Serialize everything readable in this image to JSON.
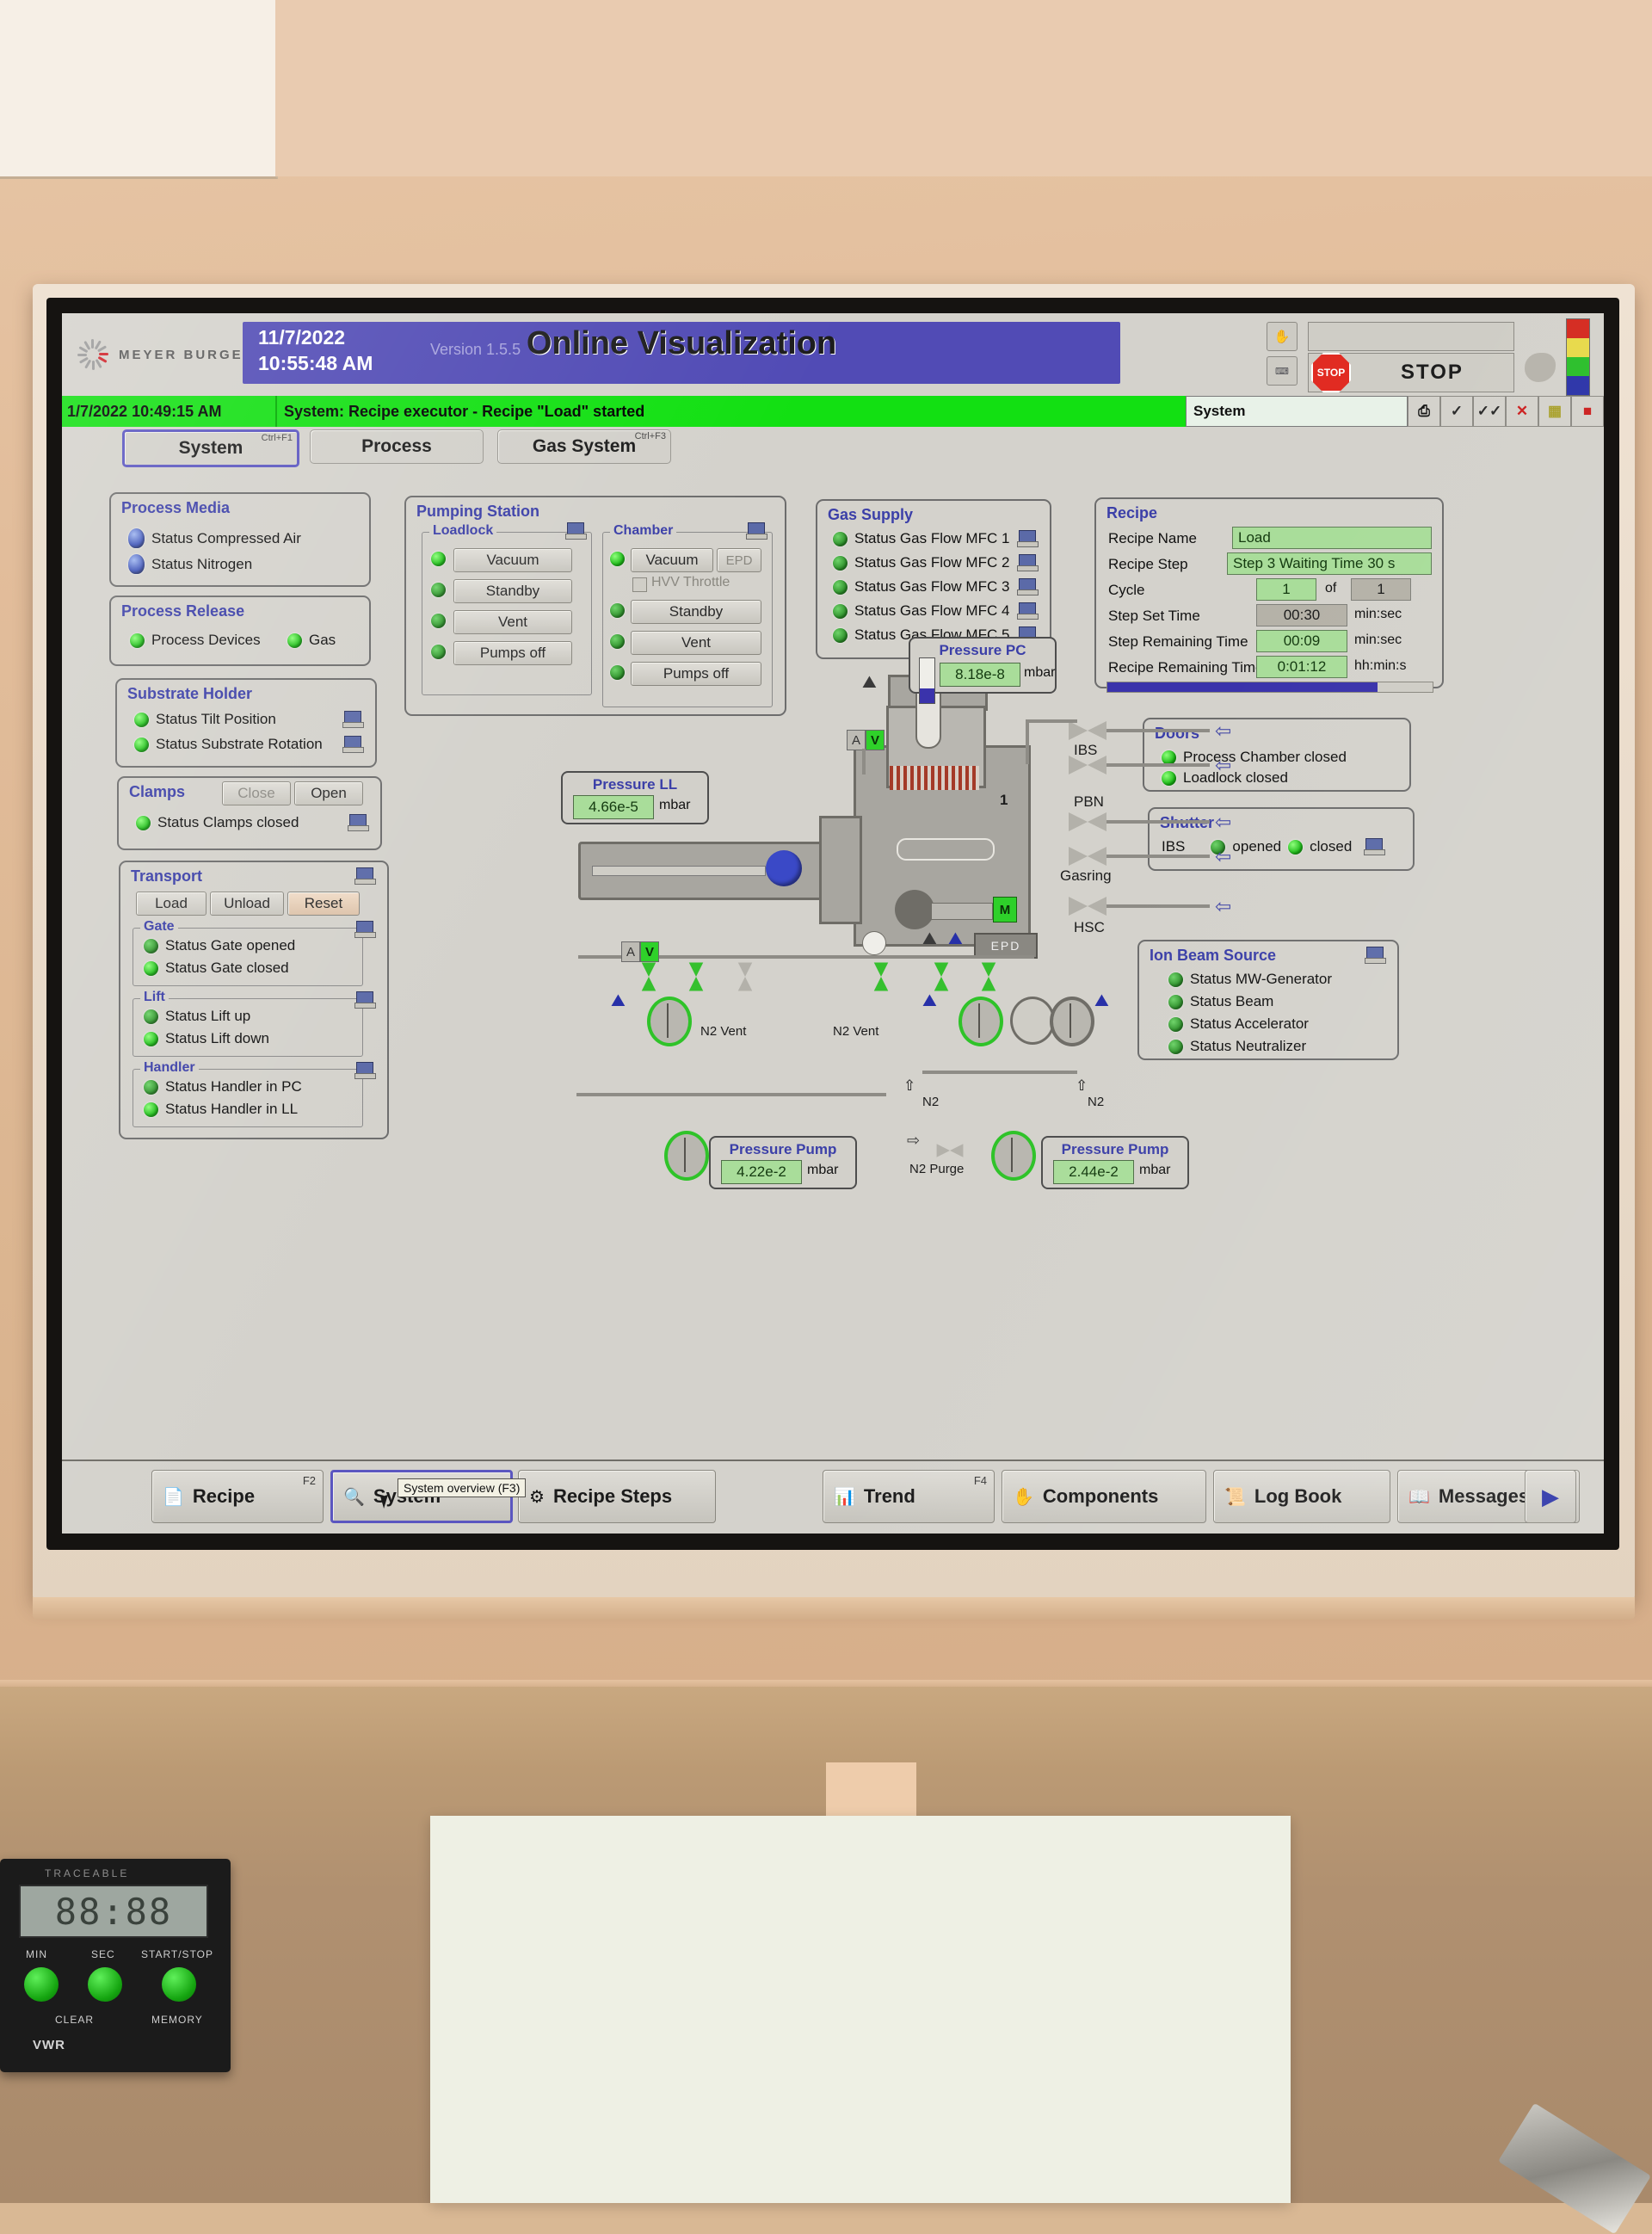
{
  "app": {
    "brand": "MEYER BURGER",
    "datetime": {
      "date": "11/7/2022",
      "time": "10:55:48 AM"
    },
    "version": "Version 1.5.5",
    "title": "Online Visualization",
    "stop_button": "STOP",
    "stop_icon_label": "STOP",
    "header_field_value": "",
    "lamp_colors": [
      "#d42a20",
      "#e8d94a",
      "#2bbf2b",
      "#2c34a8"
    ]
  },
  "alarm": {
    "time": "1/7/2022 10:49:15 AM",
    "message": "System: Recipe executor - Recipe \"Load\" started",
    "source": "System",
    "buttons": [
      "⎙",
      "✓",
      "✓✓",
      "✕",
      "▦",
      "■"
    ]
  },
  "tabs": [
    {
      "label": "System",
      "hotkey": "Ctrl+F1",
      "selected": true
    },
    {
      "label": "Process",
      "hotkey": "",
      "selected": false
    },
    {
      "label": "Gas System",
      "hotkey": "Ctrl+F3",
      "selected": false
    }
  ],
  "process_media": {
    "title": "Process Media",
    "items": [
      {
        "label": "Status Compressed Air",
        "icon": "gauge-icon"
      },
      {
        "label": "Status Nitrogen",
        "icon": "gauge-icon"
      }
    ]
  },
  "process_release": {
    "title": "Process Release",
    "items": [
      {
        "label": "Process Devices",
        "state": "on"
      },
      {
        "label": "Gas",
        "state": "on"
      }
    ]
  },
  "substrate_holder": {
    "title": "Substrate Holder",
    "items": [
      {
        "label": "Status Tilt Position",
        "state": "on"
      },
      {
        "label": "Status Substrate Rotation",
        "state": "on"
      }
    ]
  },
  "clamps": {
    "title": "Clamps",
    "buttons": [
      "Close",
      "Open"
    ],
    "items": [
      {
        "label": "Status Clamps closed",
        "state": "on"
      }
    ]
  },
  "transport": {
    "title": "Transport",
    "buttons": [
      "Load",
      "Unload",
      "Reset"
    ],
    "gate": {
      "title": "Gate",
      "items": [
        {
          "label": "Status Gate opened",
          "state": "dim"
        },
        {
          "label": "Status Gate closed",
          "state": "on"
        }
      ]
    },
    "lift": {
      "title": "Lift",
      "items": [
        {
          "label": "Status Lift up",
          "state": "dim"
        },
        {
          "label": "Status Lift down",
          "state": "on"
        }
      ]
    },
    "handler": {
      "title": "Handler",
      "items": [
        {
          "label": "Status Handler in PC",
          "state": "dim"
        },
        {
          "label": "Status Handler in LL",
          "state": "on"
        }
      ]
    }
  },
  "pumping_station": {
    "title": "Pumping Station",
    "loadlock": {
      "title": "Loadlock",
      "buttons": [
        {
          "label": "Vacuum",
          "state": "on"
        },
        {
          "label": "Standby",
          "state": "dim"
        },
        {
          "label": "Vent",
          "state": "dim"
        },
        {
          "label": "Pumps off",
          "state": "dim"
        }
      ]
    },
    "chamber": {
      "title": "Chamber",
      "vacuum": "Vacuum",
      "epd": "EPD",
      "throttle": "HVV Throttle",
      "vacuum_state": "on",
      "buttons": [
        {
          "label": "Standby",
          "state": "dim"
        },
        {
          "label": "Vent",
          "state": "dim"
        },
        {
          "label": "Pumps off",
          "state": "dim"
        }
      ]
    }
  },
  "gas_supply": {
    "title": "Gas Supply",
    "items": [
      {
        "label": "Status Gas Flow MFC 1",
        "state": "dim"
      },
      {
        "label": "Status Gas Flow MFC 2",
        "state": "dim"
      },
      {
        "label": "Status Gas Flow MFC 3",
        "state": "dim"
      },
      {
        "label": "Status Gas Flow MFC 4",
        "state": "dim"
      },
      {
        "label": "Status Gas Flow MFC 5",
        "state": "dim"
      }
    ]
  },
  "recipe": {
    "title": "Recipe",
    "fields": [
      {
        "label": "Recipe Name",
        "value": "Load",
        "unit": ""
      },
      {
        "label": "Recipe Step",
        "value": "Step 3 Waiting Time 30 s",
        "unit": ""
      },
      {
        "label": "Cycle",
        "value": "1",
        "of": "of",
        "value2": "1",
        "unit": ""
      },
      {
        "label": "Step Set Time",
        "value": "00:30",
        "unit": "min:sec"
      },
      {
        "label": "Step Remaining Time",
        "value": "00:09",
        "unit": "min:sec"
      },
      {
        "label": "Recipe Remaining Time",
        "value": "0:01:12",
        "unit": "hh:min:s"
      }
    ],
    "progress_percent": 83
  },
  "doors": {
    "title": "Doors",
    "items": [
      {
        "label": "Process Chamber closed",
        "state": "on"
      },
      {
        "label": "Loadlock closed",
        "state": "on"
      }
    ]
  },
  "shutter": {
    "title": "Shutter",
    "row_label": "IBS",
    "opened": "opened",
    "closed": "closed",
    "opened_state": "dim",
    "closed_state": "on"
  },
  "ion_beam_source": {
    "title": "Ion Beam Source",
    "items": [
      {
        "label": "Status MW-Generator",
        "state": "dim"
      },
      {
        "label": "Status Beam",
        "state": "dim"
      },
      {
        "label": "Status Accelerator",
        "state": "dim"
      },
      {
        "label": "Status Neutralizer",
        "state": "dim"
      }
    ]
  },
  "pressures": {
    "pc": {
      "title": "Pressure PC",
      "value": "8.18e-8",
      "unit": "mbar"
    },
    "ll": {
      "title": "Pressure LL",
      "value": "4.66e-5",
      "unit": "mbar"
    },
    "pump_left": {
      "title": "Pressure Pump",
      "value": "4.22e-2",
      "unit": "mbar"
    },
    "pump_right": {
      "title": "Pressure Pump",
      "value": "2.44e-2",
      "unit": "mbar"
    }
  },
  "schematic": {
    "labels": {
      "ibs": "IBS",
      "pbn": "PBN",
      "gasring": "Gasring",
      "hsc": "HSC",
      "epd": "EPD",
      "motor": "M",
      "port1": "1",
      "n2_vent_left": "N2 Vent",
      "n2_vent_right": "N2 Vent",
      "n2_left": "N2",
      "n2_right": "N2",
      "n2_purge": "N2 Purge"
    },
    "av_tags": [
      {
        "a": "A",
        "v": "V"
      },
      {
        "a": "A",
        "v": "V"
      }
    ]
  },
  "toolbar": {
    "buttons": [
      {
        "label": "Recipe",
        "hotkey": "F2",
        "icon": "recipe-icon",
        "selected": false
      },
      {
        "label": "System",
        "hotkey": "",
        "icon": "magnifier-icon",
        "selected": true
      },
      {
        "label": "Recipe Steps",
        "hotkey": "",
        "icon": "steps-icon",
        "selected": false
      },
      {
        "label": "Trend",
        "hotkey": "F4",
        "icon": "chart-icon",
        "selected": false
      },
      {
        "label": "Components",
        "hotkey": "",
        "icon": "hand-icon",
        "selected": false
      },
      {
        "label": "Log Book",
        "hotkey": "",
        "icon": "logbook-icon",
        "selected": false
      },
      {
        "label": "Messages",
        "hotkey": "",
        "icon": "messages-icon",
        "selected": false
      }
    ],
    "next_arrow": "▶",
    "tooltip": "System overview (F3)"
  },
  "timer_device": {
    "brand": "TRACEABLE",
    "display": "88:88",
    "labels": [
      "MIN",
      "SEC",
      "START/STOP",
      "CLEAR",
      "MEMORY"
    ],
    "footer": "VWR"
  }
}
